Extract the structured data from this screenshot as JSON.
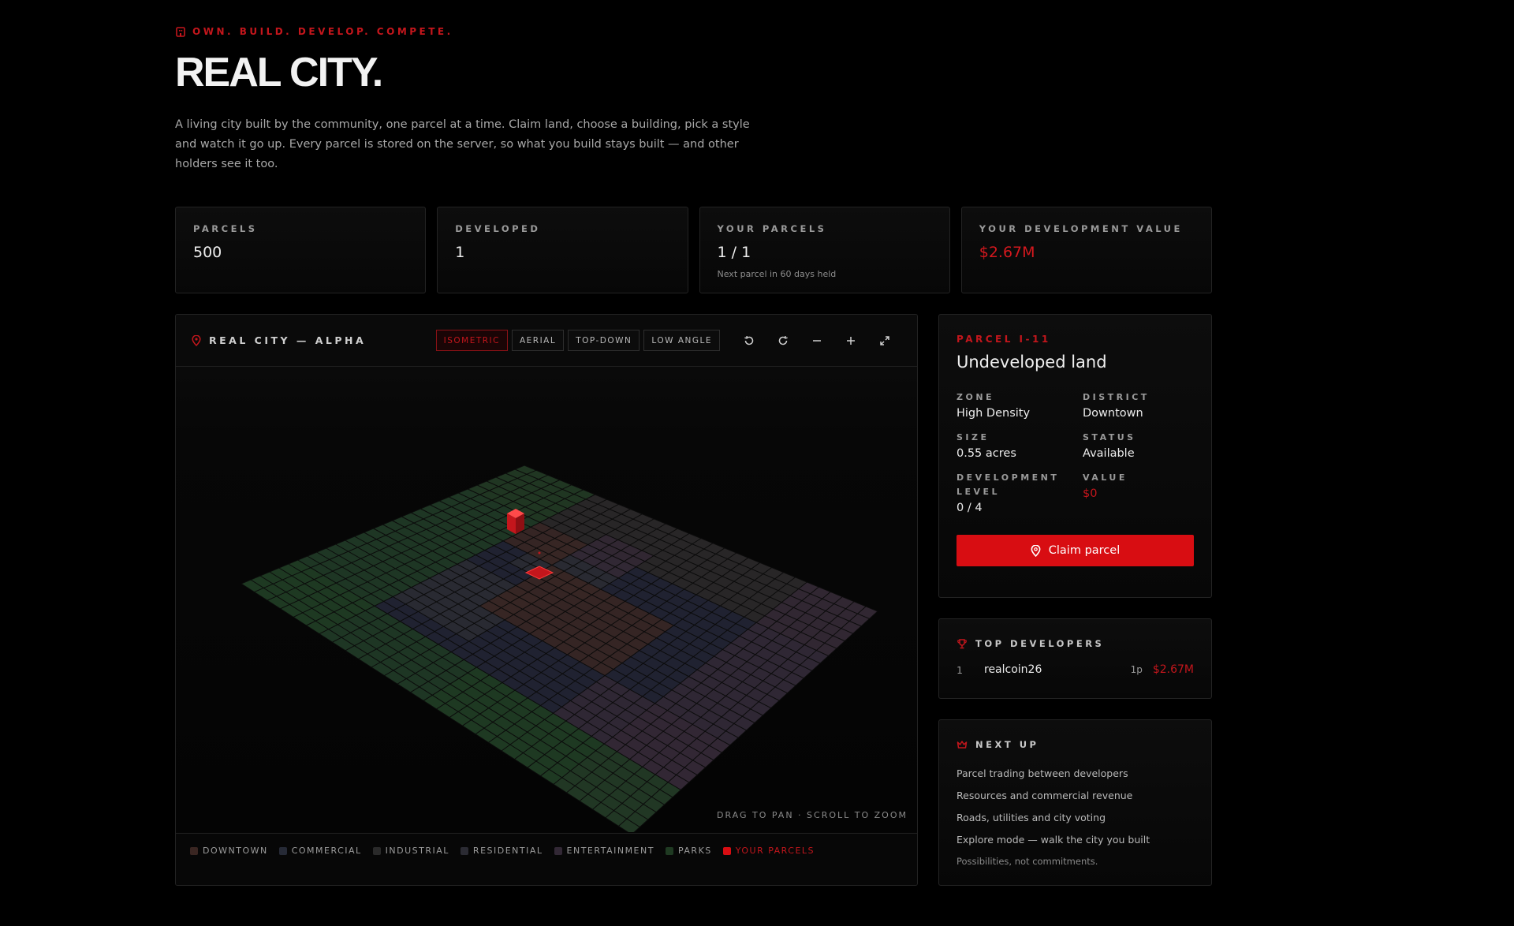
{
  "hero": {
    "eyebrow": "OWN. BUILD. DEVELOP. COMPETE.",
    "title": "REAL CITY.",
    "description": "A living city built by the community, one parcel at a time. Claim land, choose a building, pick a style and watch it go up. Every parcel is stored on the server, so what you build stays built — and other holders see it too."
  },
  "stats": [
    {
      "label": "PARCELS",
      "value": "500",
      "sub": ""
    },
    {
      "label": "DEVELOPED",
      "value": "1",
      "sub": ""
    },
    {
      "label": "YOUR PARCELS",
      "value": "1 / 1",
      "sub": "Next parcel in 60 days held"
    },
    {
      "label": "YOUR DEVELOPMENT VALUE",
      "value": "$2.67M",
      "sub": ""
    }
  ],
  "map": {
    "title": "REAL CITY — ALPHA",
    "views": [
      "ISOMETRIC",
      "AERIAL",
      "TOP-DOWN",
      "LOW ANGLE"
    ],
    "active_view": "ISOMETRIC",
    "hint": "DRAG TO PAN · SCROLL TO ZOOM",
    "legend": [
      {
        "label": "DOWNTOWN",
        "color": "#3a2622"
      },
      {
        "label": "COMMERCIAL",
        "color": "#262a36"
      },
      {
        "label": "INDUSTRIAL",
        "color": "#2a2a2a"
      },
      {
        "label": "RESIDENTIAL",
        "color": "#2b2b33"
      },
      {
        "label": "ENTERTAINMENT",
        "color": "#322835"
      },
      {
        "label": "PARKS",
        "color": "#1f3a22"
      },
      {
        "label": "YOUR PARCELS",
        "color": "#d80d12"
      }
    ]
  },
  "parcel": {
    "label": "PARCEL I-11",
    "title": "Undeveloped land",
    "fields": [
      {
        "key": "ZONE",
        "value": "High Density"
      },
      {
        "key": "DISTRICT",
        "value": "Downtown"
      },
      {
        "key": "SIZE",
        "value": "0.55 acres"
      },
      {
        "key": "STATUS",
        "value": "Available"
      },
      {
        "key": "DEVELOPMENT LEVEL",
        "value": "0 / 4"
      },
      {
        "key": "VALUE",
        "value": "$0"
      }
    ],
    "claim_label": "Claim parcel"
  },
  "top_developers": {
    "title": "TOP DEVELOPERS",
    "rows": [
      {
        "rank": "1",
        "name": "realcoin26",
        "parcels": "1p",
        "value": "$2.67M"
      }
    ]
  },
  "next_up": {
    "title": "NEXT UP",
    "items": [
      "Parcel trading between developers",
      "Resources and commercial revenue",
      "Roads, utilities and city voting",
      "Explore mode — walk the city you built"
    ],
    "note": "Possibilities, not commitments."
  },
  "colors": {
    "accent": "#d80d12",
    "background": "#000000"
  }
}
